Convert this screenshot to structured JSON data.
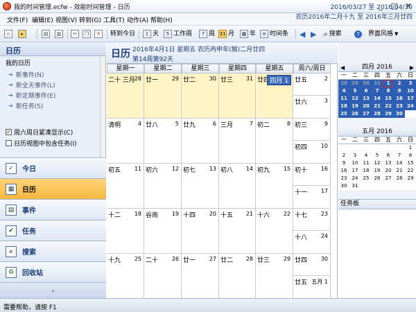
{
  "window": {
    "title": "我的时间管理.ecfw - 效能时间管理 - 日历",
    "minimize": "_",
    "maximize": "□",
    "close": "✕"
  },
  "menu": {
    "file": "文件(F)",
    "edit": "编辑(E)",
    "view": "视图(V)",
    "goto": "转到(G)",
    "tools": "工具(T)",
    "action": "动作(A)",
    "help": "帮助(H)"
  },
  "toolbar": {
    "goto_today": "转到今日",
    "day": "天",
    "day_icon": "1",
    "workweek": "工作周",
    "workweek_icon": "5",
    "week": "周",
    "week_icon": "7",
    "month": "月",
    "month_icon": "31",
    "year": "年",
    "timeline": "时间条",
    "search": "搜索",
    "theme": "界面风格"
  },
  "sidebar": {
    "header": "日历",
    "my_calendar": "我的日历",
    "links": [
      {
        "label": "新事件(N)"
      },
      {
        "label": "新全天事件(L)"
      },
      {
        "label": "新定期事件(E)"
      },
      {
        "label": "新任务(S)"
      }
    ],
    "options": [
      {
        "label": "周六周日紧凑显示(C)",
        "checked": true
      },
      {
        "label": "日历视图中包含任务(I)",
        "checked": false
      }
    ],
    "nav": [
      {
        "label": "今日",
        "icon": "calendar-check-icon"
      },
      {
        "label": "日历",
        "icon": "calendar-icon",
        "active": true
      },
      {
        "label": "事件",
        "icon": "event-icon"
      },
      {
        "label": "任务",
        "icon": "task-icon"
      },
      {
        "label": "搜索",
        "icon": "search-icon"
      },
      {
        "label": "回收站",
        "icon": "recycle-icon"
      }
    ]
  },
  "main": {
    "title": "日历",
    "date_line": "2016年4月1日 星期五 农历丙申年(猴)二月廿四",
    "week_line": "第14周第92天",
    "range_greg": "2016/03/27 至 2016/04/30",
    "range_lunar": "农历2016年二月十九 至 2016年三月廿四",
    "dow": [
      "星期一",
      "星期二",
      "星期三",
      "星期四",
      "星期五",
      "周六/周日"
    ],
    "rows": [
      {
        "cells": [
          {
            "lunar": "二十  三月",
            "num": "28",
            "cur": true
          },
          {
            "lunar": "廿一",
            "num": "29",
            "cur": true
          },
          {
            "lunar": "廿二",
            "num": "30",
            "cur": true
          },
          {
            "lunar": "廿三",
            "num": "31",
            "cur": true
          },
          {
            "lunar": "廿四",
            "num": "四月 1",
            "today": true
          }
        ],
        "sat": {
          "lunar": "廿五",
          "num": "2"
        },
        "sun": {
          "lunar": "廿六",
          "num": "3"
        }
      },
      {
        "cells": [
          {
            "lunar": "清明",
            "num": "4"
          },
          {
            "lunar": "廿八",
            "num": "5"
          },
          {
            "lunar": "廿九",
            "num": "6"
          },
          {
            "lunar": "三月",
            "num": "7"
          },
          {
            "lunar": "初二",
            "num": "8"
          }
        ],
        "sat": {
          "lunar": "初三",
          "num": "9"
        },
        "sun": {
          "lunar": "初四",
          "num": "10"
        }
      },
      {
        "cells": [
          {
            "lunar": "初五",
            "num": "11"
          },
          {
            "lunar": "初六",
            "num": "12"
          },
          {
            "lunar": "初七",
            "num": "13"
          },
          {
            "lunar": "初八",
            "num": "14"
          },
          {
            "lunar": "初九",
            "num": "15"
          }
        ],
        "sat": {
          "lunar": "初十",
          "num": "16"
        },
        "sun": {
          "lunar": "十一",
          "num": "17"
        }
      },
      {
        "cells": [
          {
            "lunar": "十二",
            "num": "18"
          },
          {
            "lunar": "谷雨",
            "num": "19"
          },
          {
            "lunar": "十四",
            "num": "20"
          },
          {
            "lunar": "十五",
            "num": "21"
          },
          {
            "lunar": "十六",
            "num": "22"
          }
        ],
        "sat": {
          "lunar": "十七",
          "num": "23"
        },
        "sun": {
          "lunar": "十八",
          "num": "24"
        }
      },
      {
        "cells": [
          {
            "lunar": "十九",
            "num": "25"
          },
          {
            "lunar": "二十",
            "num": "26"
          },
          {
            "lunar": "廿一",
            "num": "27"
          },
          {
            "lunar": "廿二",
            "num": "28"
          },
          {
            "lunar": "廿三",
            "num": "29"
          }
        ],
        "sat": {
          "lunar": "廿四",
          "num": "30"
        },
        "sun": {
          "lunar": "廿五",
          "num": "五月 1"
        }
      }
    ]
  },
  "mini_april": {
    "title": "四月 2016",
    "prev": "◀",
    "next": "▶",
    "dow": [
      "一",
      "二",
      "三",
      "四",
      "五",
      "六",
      "日"
    ],
    "rows": [
      [
        "28",
        "29",
        "30",
        "31",
        "1",
        "2",
        "3"
      ],
      [
        "4",
        "5",
        "6",
        "7",
        "8",
        "9",
        "10"
      ],
      [
        "11",
        "12",
        "13",
        "14",
        "15",
        "16",
        "17"
      ],
      [
        "18",
        "19",
        "20",
        "21",
        "22",
        "23",
        "24"
      ],
      [
        "25",
        "26",
        "27",
        "28",
        "29",
        "30",
        ""
      ]
    ]
  },
  "mini_may": {
    "title": "五月 2016",
    "dow": [
      "一",
      "二",
      "三",
      "四",
      "五",
      "六",
      "日"
    ],
    "rows": [
      [
        "",
        "",
        "",
        "",
        "",
        "",
        "1"
      ],
      [
        "2",
        "3",
        "4",
        "5",
        "6",
        "7",
        "8"
      ],
      [
        "9",
        "10",
        "11",
        "12",
        "13",
        "14",
        "15"
      ],
      [
        "16",
        "17",
        "18",
        "19",
        "20",
        "21",
        "22"
      ],
      [
        "23",
        "24",
        "25",
        "26",
        "27",
        "28",
        "29"
      ],
      [
        "30",
        "31",
        "",
        "",
        "",
        "",
        ""
      ]
    ]
  },
  "taskboard": {
    "title": "任务板"
  },
  "status": {
    "text": "需要帮助，请按 F1"
  }
}
